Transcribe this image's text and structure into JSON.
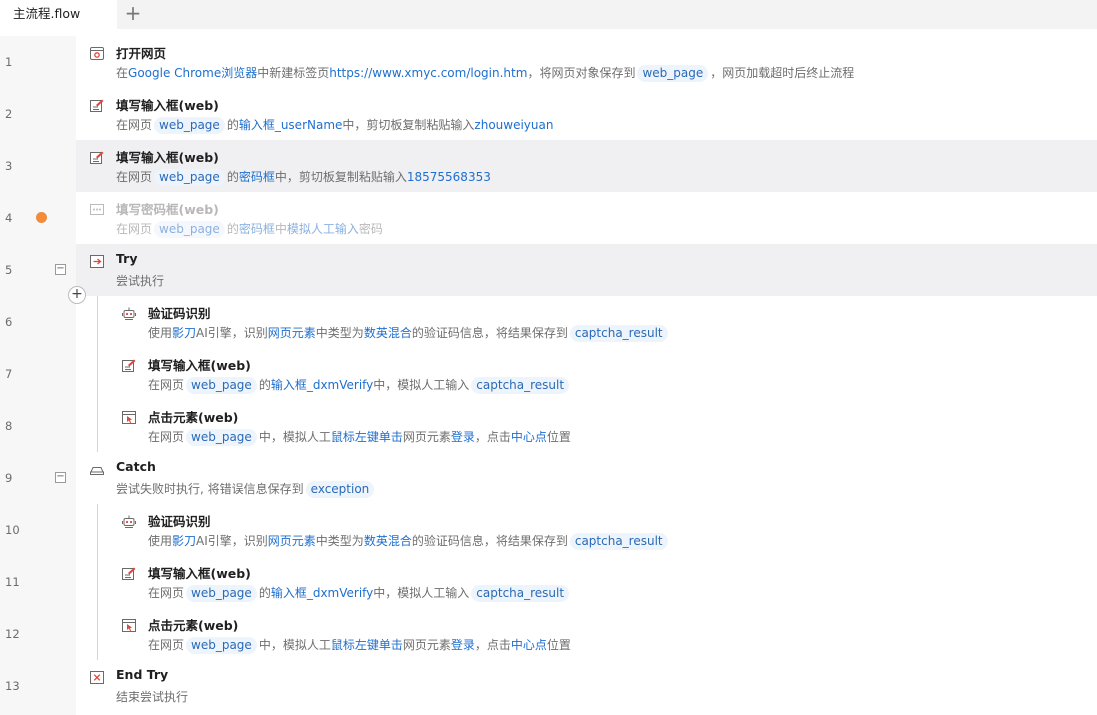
{
  "tab": {
    "label": "主流程.flow",
    "add_label": "+"
  },
  "insert_label": "+",
  "fold_label": "−",
  "rows": [
    {
      "line": "1",
      "title": "打开网页",
      "desc": [
        "在",
        {
          "h": "Google Chrome浏览器"
        },
        "中新建标签页",
        {
          "h": "https://www.xmyc.com/login.htm"
        },
        "，将网页对象保存到",
        {
          "v": "web_page"
        },
        "，网页加载超时后终止流程"
      ]
    },
    {
      "line": "2",
      "title": "填写输入框(web)",
      "desc": [
        "在网页",
        {
          "v": "web_page"
        },
        "的",
        {
          "h": "输入框_userName"
        },
        "中，剪切板复制粘贴输入",
        {
          "h": "zhouweiyuan"
        }
      ]
    },
    {
      "line": "3",
      "title": "填写输入框(web)",
      "desc": [
        "在网页",
        {
          "v": "web_page"
        },
        "的",
        {
          "h": "密码框"
        },
        "中，剪切板复制粘贴输入",
        {
          "h": "18575568353"
        }
      ]
    },
    {
      "line": "4",
      "title": "填写密码框(web)",
      "desc": [
        "在网页",
        {
          "v": "web_page"
        },
        "的",
        {
          "h": "密码框"
        },
        "中",
        {
          "h": "模拟人工输入"
        },
        "密码"
      ]
    },
    {
      "line": "5",
      "title": "Try",
      "desc": [
        "尝试执行"
      ]
    },
    {
      "line": "6",
      "title": "验证码识别",
      "desc": [
        "使用",
        {
          "h": "影刀"
        },
        "AI引擎，识别",
        {
          "h": "网页元素"
        },
        "中类型为",
        {
          "h": "数英混合"
        },
        "的验证码信息，将结果保存到",
        {
          "v": "captcha_result"
        }
      ]
    },
    {
      "line": "7",
      "title": "填写输入框(web)",
      "desc": [
        "在网页",
        {
          "v": "web_page"
        },
        "的",
        {
          "h": "输入框_dxmVerify"
        },
        "中，模拟人工输入",
        {
          "v": "captcha_result"
        }
      ]
    },
    {
      "line": "8",
      "title": "点击元素(web)",
      "desc": [
        "在网页",
        {
          "v": "web_page"
        },
        "中，模拟人工",
        {
          "h": "鼠标左键单击"
        },
        "网页元素",
        {
          "h": "登录"
        },
        "，点击",
        {
          "h": "中心点"
        },
        "位置"
      ]
    },
    {
      "line": "9",
      "title": "Catch",
      "desc": [
        "尝试失败时执行, 将错误信息保存到",
        {
          "v": "exception"
        }
      ]
    },
    {
      "line": "10",
      "title": "验证码识别",
      "desc": [
        "使用",
        {
          "h": "影刀"
        },
        "AI引擎，识别",
        {
          "h": "网页元素"
        },
        "中类型为",
        {
          "h": "数英混合"
        },
        "的验证码信息，将结果保存到",
        {
          "v": "captcha_result"
        }
      ]
    },
    {
      "line": "11",
      "title": "填写输入框(web)",
      "desc": [
        "在网页",
        {
          "v": "web_page"
        },
        "的",
        {
          "h": "输入框_dxmVerify"
        },
        "中，模拟人工输入",
        {
          "v": "captcha_result"
        }
      ]
    },
    {
      "line": "12",
      "title": "点击元素(web)",
      "desc": [
        "在网页",
        {
          "v": "web_page"
        },
        "中，模拟人工",
        {
          "h": "鼠标左键单击"
        },
        "网页元素",
        {
          "h": "登录"
        },
        "，点击",
        {
          "h": "中心点"
        },
        "位置"
      ]
    },
    {
      "line": "13",
      "title": "End Try",
      "desc": [
        "结束尝试执行"
      ]
    }
  ],
  "colors": {
    "link": "#1e6fcf",
    "variable_bg": "#eef4fb",
    "breakpoint": "#f28b3c",
    "selected_row": "#f0f0f2"
  },
  "icons": [
    "browser-open-icon",
    "form-fill-icon",
    "form-fill-icon",
    "password-fill-icon",
    "try-icon",
    "captcha-robot-icon",
    "form-fill-icon",
    "click-element-icon",
    "catch-icon",
    "captcha-robot-icon",
    "form-fill-icon",
    "click-element-icon",
    "end-try-icon"
  ]
}
